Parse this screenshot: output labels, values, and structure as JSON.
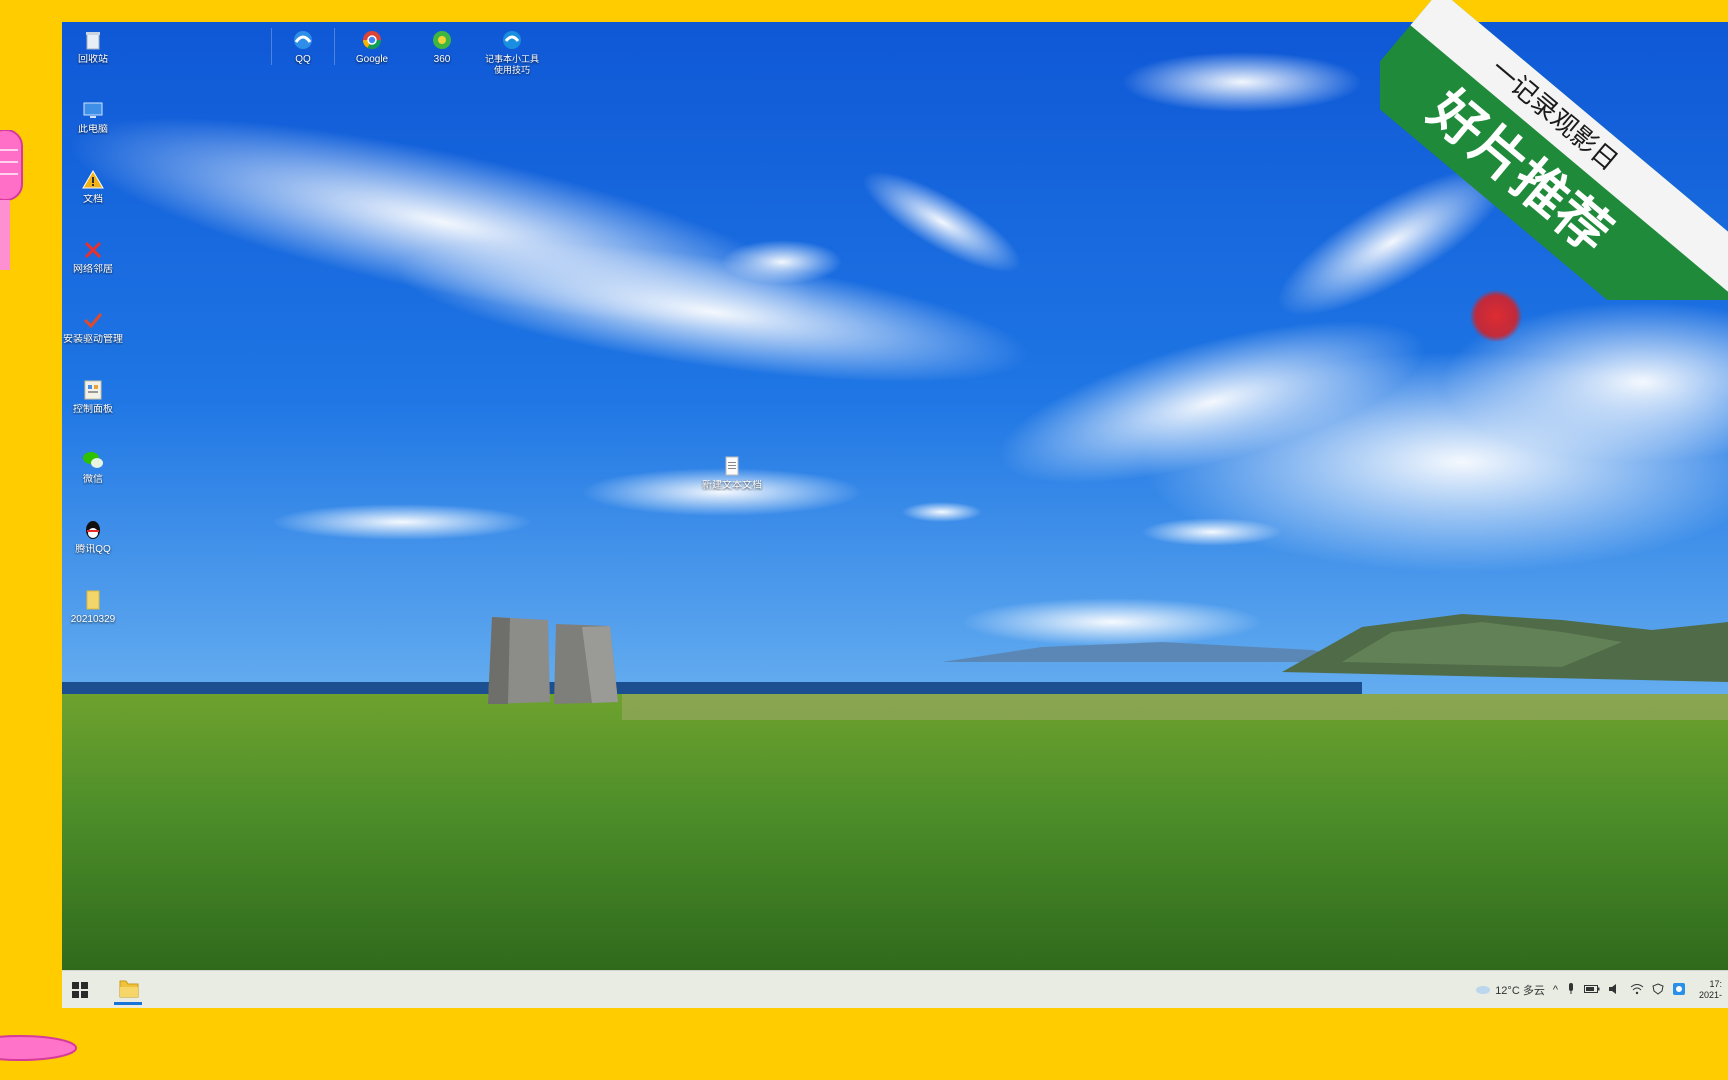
{
  "desktop": {
    "left_icons": [
      {
        "label": "回收站",
        "icon": "recycle-bin-icon"
      },
      {
        "label": "此电脑",
        "icon": "computer-icon"
      },
      {
        "label": "文档",
        "icon": "warning-icon"
      },
      {
        "label": "网络邻居",
        "icon": "network-icon"
      },
      {
        "label": "安装驱动管理",
        "icon": "check-icon"
      },
      {
        "label": "控制面板",
        "icon": "control-panel-icon"
      },
      {
        "label": "微信",
        "icon": "wechat-icon"
      },
      {
        "label": "腾讯QQ",
        "icon": "qq-icon"
      },
      {
        "label": "20210329",
        "icon": "folder-icon"
      }
    ],
    "top_icons": [
      {
        "label": "QQ",
        "icon": "edge-browser-icon"
      },
      {
        "label": "Google",
        "icon": "chrome-icon"
      },
      {
        "label": "360",
        "icon": "360-browser-icon"
      },
      {
        "label": "记事本小工具使用技巧",
        "icon": "edge-shortcut-icon"
      }
    ],
    "center_file": {
      "label": "新建文本文档",
      "icon": "text-file-icon"
    }
  },
  "taskbar": {
    "weather": "12°C 多云",
    "clock_time": "17:",
    "clock_date": "2021-"
  },
  "ribbon": {
    "upper_text": "一记录观影日",
    "lower_text": "好片推荐"
  },
  "colors": {
    "frame_yellow": "#ffcc00",
    "sky_blue": "#1466d8",
    "grass_green": "#4f8f2a",
    "ribbon_green": "#1f8a3a",
    "taskbar": "#e8ece2"
  }
}
